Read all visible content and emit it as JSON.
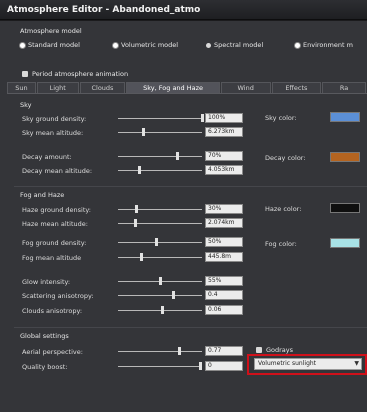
{
  "window": {
    "title": "Atmosphere Editor - Abandoned_atmo"
  },
  "atmosphere_model": {
    "label": "Atmosphere model",
    "options": [
      {
        "label": "Standard model",
        "selected": true
      },
      {
        "label": "Volumetric model",
        "selected": true
      },
      {
        "label": "Spectral model",
        "selected": false
      },
      {
        "label": "Environment m",
        "selected": true
      }
    ]
  },
  "periodic_animation": {
    "label": "Period atmosphere animation"
  },
  "tabs": [
    {
      "label": "Sun",
      "active": false
    },
    {
      "label": "Light",
      "active": false
    },
    {
      "label": "Clouds",
      "active": false
    },
    {
      "label": "Sky, Fog and Haze",
      "active": true
    },
    {
      "label": "Wind",
      "active": false
    },
    {
      "label": "Effects",
      "active": false
    },
    {
      "label": "Ra",
      "active": false
    }
  ],
  "sky": {
    "heading": "Sky",
    "rows": [
      {
        "label": "Sky ground density:",
        "value": "100%",
        "level": 1.0
      },
      {
        "label": "Sky mean altitude:",
        "value": "6.273km",
        "level": 0.3
      },
      {
        "label": "Decay amount:",
        "value": "70%",
        "level": 0.7
      },
      {
        "label": "Decay mean altitude:",
        "value": "4.053km",
        "level": 0.25
      }
    ],
    "sky_color": {
      "label": "Sky color:",
      "color": "#5b8fd6"
    },
    "decay_color": {
      "label": "Decay color:",
      "color": "#b46420"
    }
  },
  "fog_haze": {
    "heading": "Fog and Haze",
    "rows": [
      {
        "label": "Haze ground density:",
        "value": "30%",
        "level": 0.22
      },
      {
        "label": "Haze mean altitude:",
        "value": "2.074km",
        "level": 0.2
      },
      {
        "label": "Fog ground density:",
        "value": "50%",
        "level": 0.45
      },
      {
        "label": "Fog mean altitude",
        "value": "445.8m",
        "level": 0.27
      },
      {
        "label": "Glow intensity:",
        "value": "55%",
        "level": 0.5
      },
      {
        "label": "Scattering anisotropy:",
        "value": "0.4",
        "level": 0.65
      },
      {
        "label": "Clouds anisotropy:",
        "value": "0.06",
        "level": 0.52
      }
    ],
    "haze_color": {
      "label": "Haze color:",
      "color": "#0f0f0f"
    },
    "fog_color": {
      "label": "Fog color:",
      "color": "#a8e2e6"
    }
  },
  "global": {
    "heading": "Global settings",
    "rows": [
      {
        "label": "Aerial perspective:",
        "value": "0.77",
        "level": 0.73
      },
      {
        "label": "Quality boost:",
        "value": "0",
        "level": 0.98
      }
    ],
    "godrays": {
      "label": "Godrays"
    },
    "quality_mode": {
      "value": "Volumetric sunlight"
    }
  },
  "colors": {
    "highlight": "#d0101a",
    "panel": "#343539"
  }
}
